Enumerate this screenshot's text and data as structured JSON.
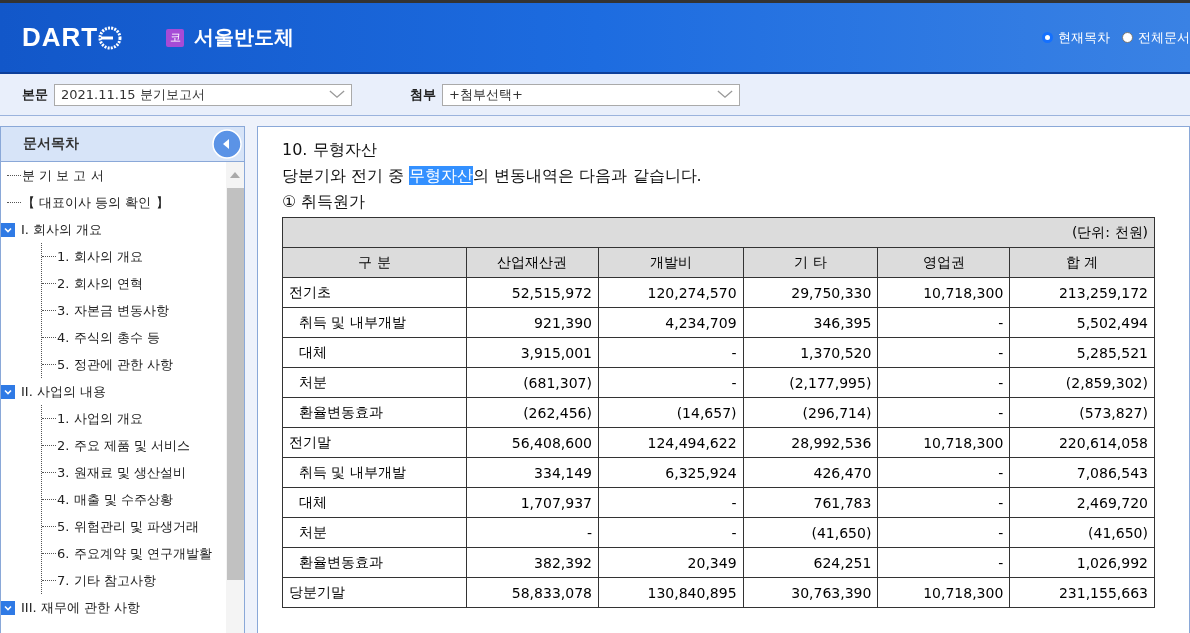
{
  "header": {
    "logo": "DART",
    "company_badge": "코",
    "company": "서울반도체",
    "view_options": [
      {
        "label": "현재목차",
        "selected": true
      },
      {
        "label": "전체문서",
        "selected": false
      }
    ]
  },
  "toolbar": {
    "main_label": "본문",
    "main_value": "2021.11.15  분기보고서",
    "attach_label": "첨부",
    "attach_value": "+첨부선택+"
  },
  "sidebar": {
    "title": "문서목차",
    "items": [
      {
        "label": "분 기 보 고 서"
      },
      {
        "label": "【 대표이사 등의 확인 】"
      },
      {
        "label": "I. 회사의 개요",
        "expanded": true,
        "children": [
          {
            "label": "1. 회사의 개요"
          },
          {
            "label": "2. 회사의 연혁"
          },
          {
            "label": "3. 자본금 변동사항"
          },
          {
            "label": "4. 주식의 총수 등"
          },
          {
            "label": "5. 정관에 관한 사항"
          }
        ]
      },
      {
        "label": "II. 사업의 내용",
        "expanded": true,
        "children": [
          {
            "label": "1. 사업의 개요"
          },
          {
            "label": "2. 주요 제품 및 서비스"
          },
          {
            "label": "3. 원재료 및 생산설비"
          },
          {
            "label": "4. 매출 및 수주상황"
          },
          {
            "label": "5. 위험관리 및 파생거래"
          },
          {
            "label": "6. 주요계약 및 연구개발활"
          },
          {
            "label": "7. 기타 참고사항"
          }
        ]
      },
      {
        "label": "III. 재무에 관한 사항",
        "expanded": true
      }
    ]
  },
  "content": {
    "heading": "10. 무형자산",
    "intro": [
      {
        "text": "당분기와 전기 중 ",
        "selected": false
      },
      {
        "text": "무형자산",
        "selected": true
      },
      {
        "text": "의 변동내역은 다음과 같습니다.",
        "selected": false
      }
    ],
    "subheading": "① 취득원가",
    "table": {
      "unit": "(단위: 천원)",
      "columns": [
        "구  분",
        "산업재산권",
        "개발비",
        "기  타",
        "영업권",
        "합  계"
      ],
      "rows": [
        {
          "indent": false,
          "cells": [
            "전기초",
            "52,515,972",
            "120,274,570",
            "29,750,330",
            "10,718,300",
            "213,259,172"
          ]
        },
        {
          "indent": true,
          "cells": [
            "취득 및 내부개발",
            "921,390",
            "4,234,709",
            "346,395",
            "-",
            "5,502,494"
          ]
        },
        {
          "indent": true,
          "cells": [
            "대체",
            "3,915,001",
            "-",
            "1,370,520",
            "-",
            "5,285,521"
          ]
        },
        {
          "indent": true,
          "cells": [
            "처분",
            "(681,307)",
            "-",
            "(2,177,995)",
            "-",
            "(2,859,302)"
          ]
        },
        {
          "indent": true,
          "cells": [
            "환율변동효과",
            "(262,456)",
            "(14,657)",
            "(296,714)",
            "-",
            "(573,827)"
          ]
        },
        {
          "indent": false,
          "cells": [
            "전기말",
            "56,408,600",
            "124,494,622",
            "28,992,536",
            "10,718,300",
            "220,614,058"
          ]
        },
        {
          "indent": true,
          "cells": [
            "취득 및 내부개발",
            "334,149",
            "6,325,924",
            "426,470",
            "-",
            "7,086,543"
          ]
        },
        {
          "indent": true,
          "cells": [
            "대체",
            "1,707,937",
            "-",
            "761,783",
            "-",
            "2,469,720"
          ]
        },
        {
          "indent": true,
          "cells": [
            "처분",
            "-",
            "-",
            "(41,650)",
            "-",
            "(41,650)"
          ]
        },
        {
          "indent": true,
          "cells": [
            "환율변동효과",
            "382,392",
            "20,349",
            "624,251",
            "-",
            "1,026,992"
          ]
        },
        {
          "indent": false,
          "cells": [
            "당분기말",
            "58,833,078",
            "130,840,895",
            "30,763,390",
            "10,718,300",
            "231,155,663"
          ]
        }
      ]
    }
  }
}
